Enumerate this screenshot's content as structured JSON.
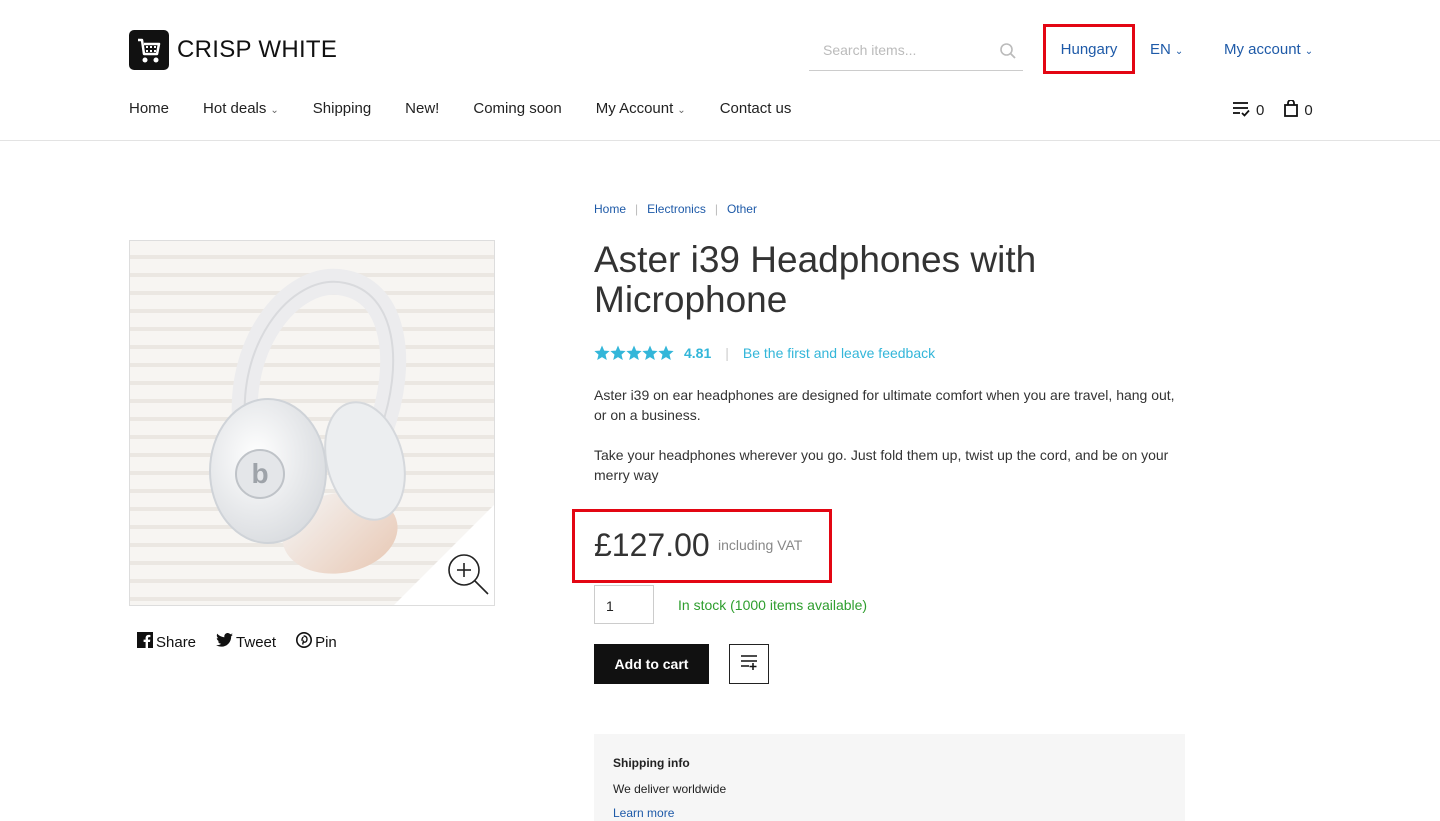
{
  "header": {
    "logo_text": "CRISP WHITE",
    "search_placeholder": "Search items...",
    "country": "Hungary",
    "language": "EN",
    "account": "My account",
    "wishlist_count": "0",
    "cart_count": "0"
  },
  "nav": {
    "items": [
      {
        "label": "Home",
        "dropdown": false
      },
      {
        "label": "Hot deals",
        "dropdown": true
      },
      {
        "label": "Shipping",
        "dropdown": false
      },
      {
        "label": "New!",
        "dropdown": false
      },
      {
        "label": "Coming soon",
        "dropdown": false
      },
      {
        "label": "My Account",
        "dropdown": true
      },
      {
        "label": "Contact us",
        "dropdown": false
      }
    ]
  },
  "breadcrumb": [
    "Home",
    "Electronics",
    "Other"
  ],
  "product": {
    "title": "Aster i39 Headphones with Microphone",
    "rating": "4.81",
    "feedback_link": "Be the first and leave feedback",
    "description": [
      "Aster i39 on ear headphones are designed for ultimate comfort when you are travel, hang out, or on a business.",
      "Take your headphones wherever you go. Just fold them up, twist up the cord, and be on your merry way"
    ],
    "price": "£127.00",
    "vat_note": "including VAT",
    "quantity": "1",
    "stock": "In stock (1000 items available)",
    "add_to_cart": "Add to cart"
  },
  "share": {
    "facebook": "Share",
    "twitter": "Tweet",
    "pinterest": "Pin"
  },
  "shipping": {
    "title": "Shipping info",
    "text": "We deliver worldwide",
    "link": "Learn more"
  },
  "colors": {
    "link_blue": "#1e5aa8",
    "accent_teal": "#33b6d9",
    "stock_green": "#2e9e2e",
    "highlight_red": "#e30613"
  }
}
